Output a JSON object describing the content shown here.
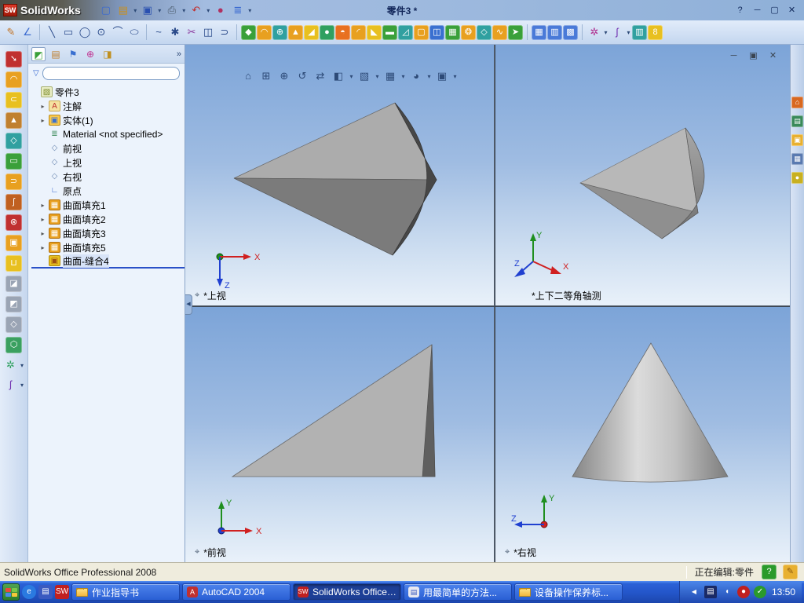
{
  "title_bar": {
    "app_name": "SolidWorks",
    "logo_text": "SW",
    "doc_title": "零件3 *"
  },
  "feature_tree": {
    "root": "零件3",
    "items": [
      {
        "label": "注解"
      },
      {
        "label": "实体(1)"
      },
      {
        "label": "Material <not specified>"
      },
      {
        "label": "前视"
      },
      {
        "label": "上视"
      },
      {
        "label": "右视"
      },
      {
        "label": "原点"
      },
      {
        "label": "曲面填充1"
      },
      {
        "label": "曲面填充2"
      },
      {
        "label": "曲面填充3"
      },
      {
        "label": "曲面填充5"
      },
      {
        "label": "曲面-缝合4"
      }
    ]
  },
  "viewports": {
    "top_left": {
      "label": "*上视"
    },
    "top_right": {
      "label": "*上下二等角轴测"
    },
    "bottom_left": {
      "label": "*前视"
    },
    "bottom_right": {
      "label": "*右视"
    }
  },
  "triad": {
    "x": "X",
    "y": "Y",
    "z": "Z"
  },
  "status_bar": {
    "product": "SolidWorks Office Professional 2008",
    "editing": "正在编辑:零件"
  },
  "taskbar": {
    "tasks": [
      {
        "label": "作业指导书"
      },
      {
        "label": "AutoCAD 2004"
      },
      {
        "label": "SolidWorks Office ..."
      },
      {
        "label": "用最简单的方法..."
      },
      {
        "label": "设备操作保养标..."
      }
    ],
    "time": "13:50"
  },
  "colors": {
    "accent": "#2a50c8",
    "viewport_top": "#7ca4d8",
    "viewport_bottom": "#e9f1fa",
    "taskbar_blue": "#2457cb"
  }
}
